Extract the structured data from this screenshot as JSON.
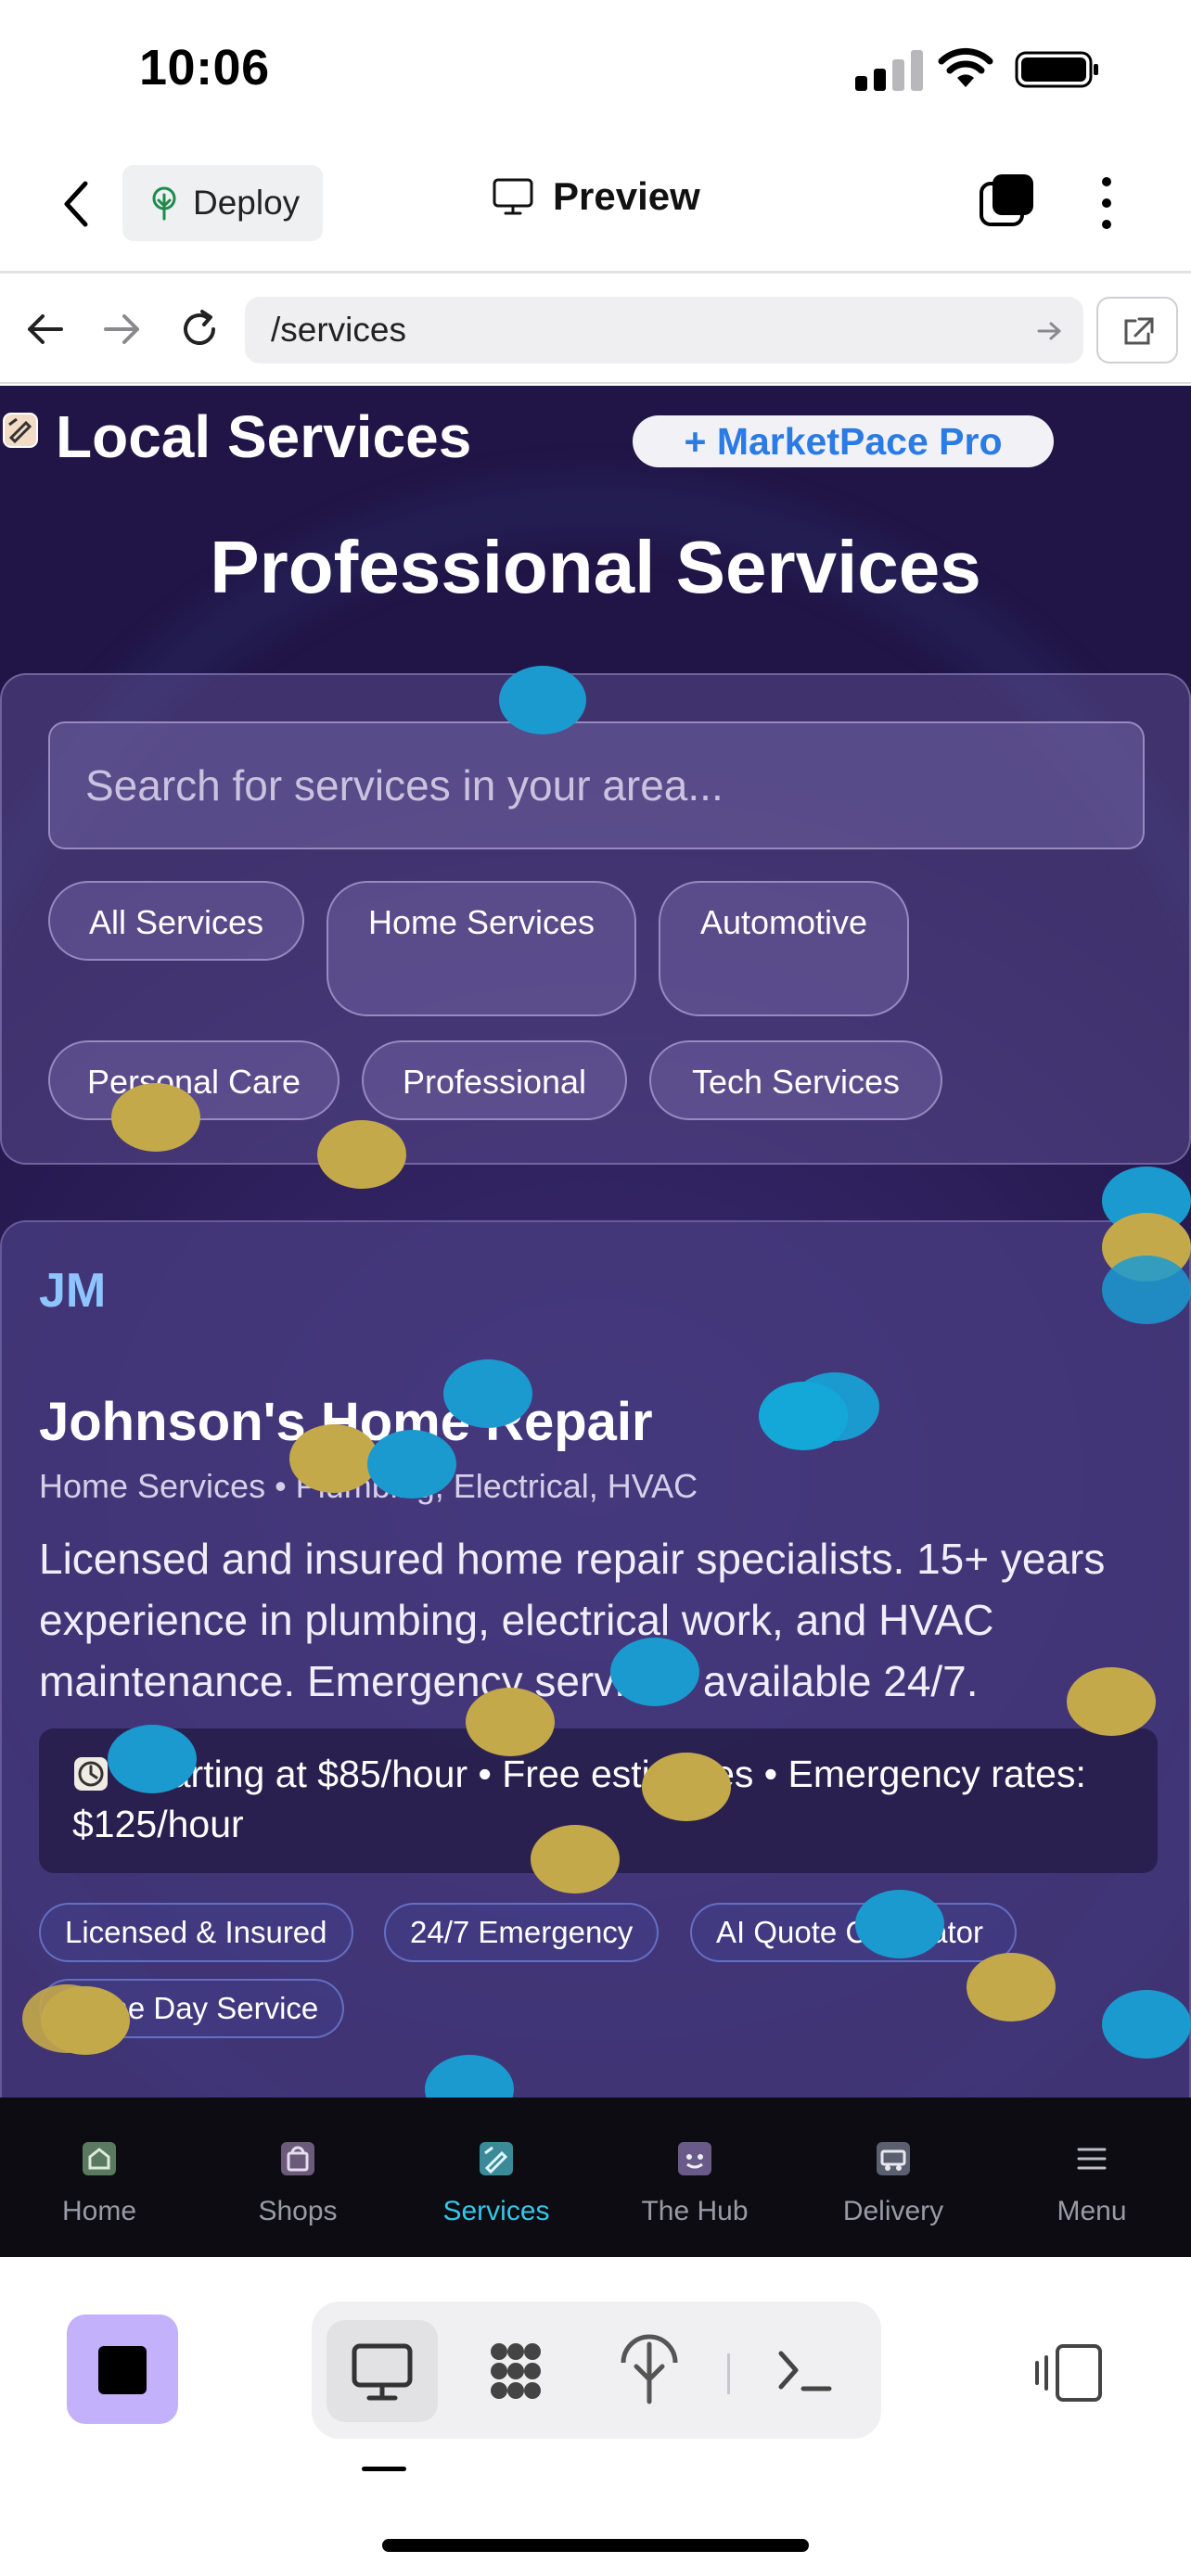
{
  "status_bar": {
    "time": "10:06"
  },
  "app_header": {
    "deploy_label": "Deploy",
    "preview_label": "Preview"
  },
  "browser": {
    "url": "/services"
  },
  "site": {
    "title": "Local Services",
    "pro_button": "+ MarketPace Pro",
    "hero_title": "Professional Services",
    "search_placeholder": "Search for services in your area...",
    "categories": [
      "All Services",
      "Home Services",
      "Automotive",
      "Personal Care",
      "Professional",
      "Tech Services"
    ]
  },
  "listing": {
    "avatar_initials": "JM",
    "name": "Johnson's Home Repair",
    "category": "Home Services • Plumbing, Electrical, HVAC",
    "description": "Licensed and insured home repair specialists. 15+ years experience in plumbing, electrical work, and HVAC maintenance. Emergency services available 24/7.",
    "pricing": "Starting at $85/hour • Free estimates • Emergency rates: $125/hour",
    "tags": [
      "Licensed & Insured",
      "24/7 Emergency",
      "AI Quote Calculator",
      "Same Day Service"
    ]
  },
  "bottom_nav": {
    "items": [
      "Home",
      "Shops",
      "Services",
      "The Hub",
      "Delivery",
      "Menu"
    ],
    "active": "Services"
  },
  "colors": {
    "accent": "#35c5e8",
    "pro_text": "#2a7be4",
    "page_bg": "#2c1f5a",
    "stop_button": "#c3b1fb"
  }
}
